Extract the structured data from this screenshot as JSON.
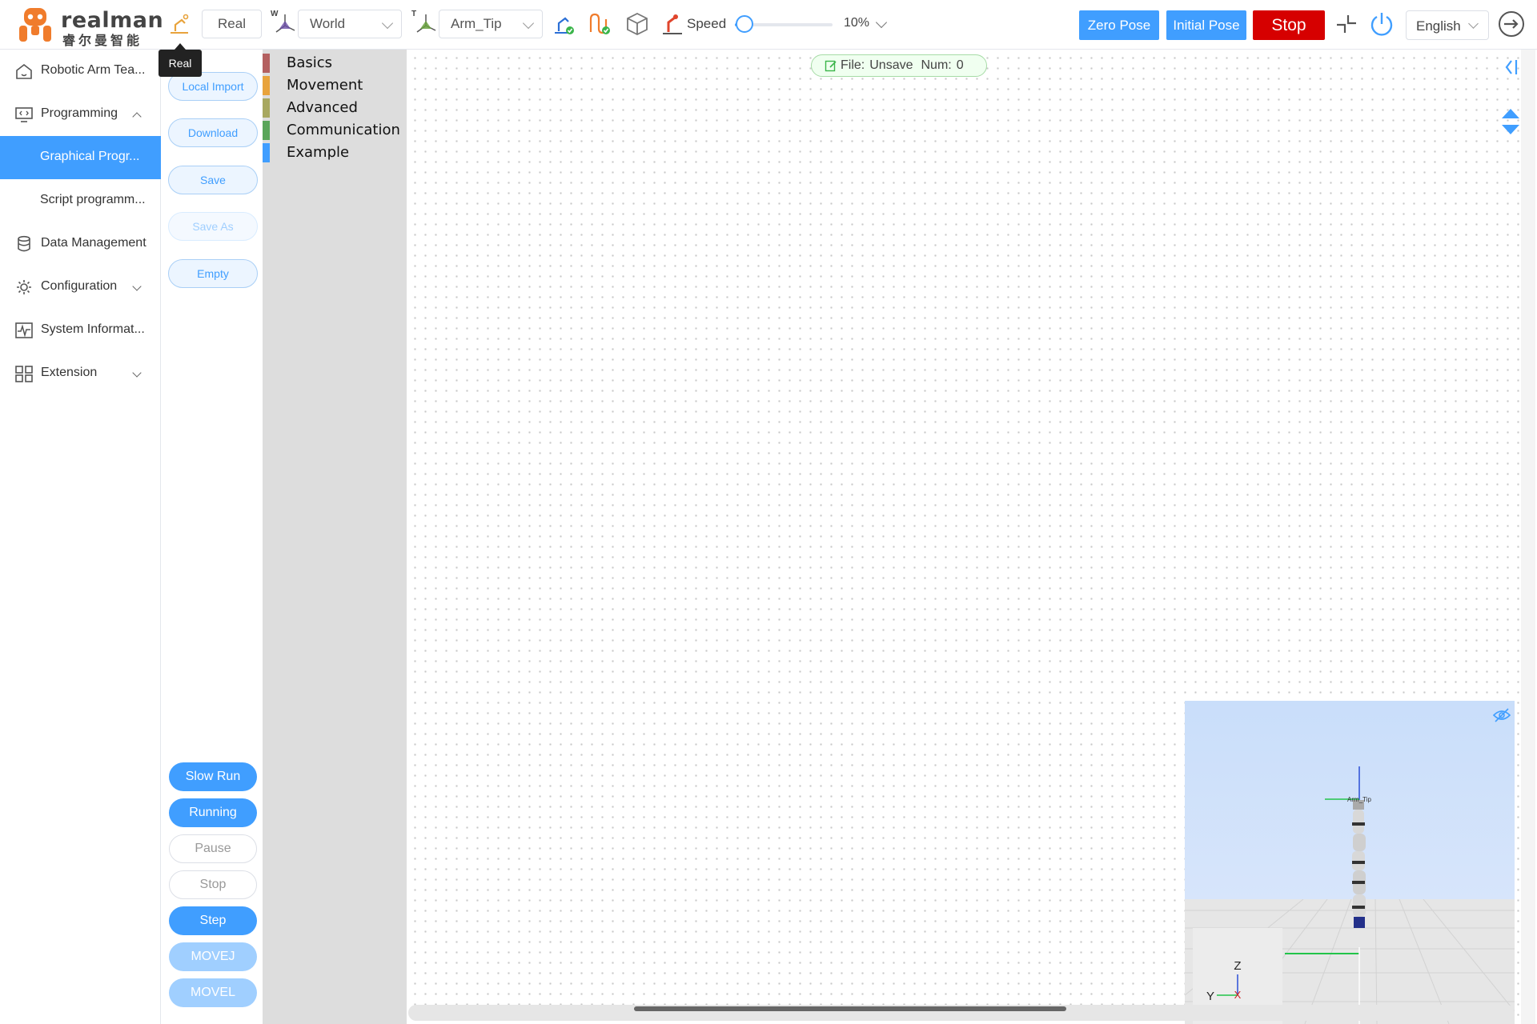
{
  "brand": {
    "name_en": "realman",
    "name_cn": "睿尔曼智能"
  },
  "toolbar": {
    "mode_value": "Real",
    "mode_tooltip": "Real",
    "frame_axis": "W",
    "frame_value": "World",
    "tool_axis": "T",
    "tool_value": "Arm_Tip",
    "speed_label": "Speed",
    "speed_value": "10%",
    "speed_percent": 10,
    "zero_pose": "Zero Pose",
    "initial_pose": "Initial Pose",
    "stop": "Stop",
    "language": "English"
  },
  "sidebar": {
    "items": [
      {
        "label": "Robotic Arm Tea..."
      },
      {
        "label": "Programming"
      },
      {
        "label": "Graphical Progr..."
      },
      {
        "label": "Script programm..."
      },
      {
        "label": "Data Management"
      },
      {
        "label": "Configuration"
      },
      {
        "label": "System Informat..."
      },
      {
        "label": "Extension"
      }
    ]
  },
  "tools": {
    "local_import": "Local Import",
    "download": "Download",
    "save": "Save",
    "save_as": "Save As",
    "empty": "Empty"
  },
  "run": {
    "slow_run": "Slow Run",
    "running": "Running",
    "pause": "Pause",
    "stop": "Stop",
    "step": "Step",
    "movej": "MOVEJ",
    "movel": "MOVEL"
  },
  "toolbox": {
    "categories": [
      {
        "label": "Basics",
        "color": "#b46060"
      },
      {
        "label": "Movement",
        "color": "#e8a33c"
      },
      {
        "label": "Advanced",
        "color": "#a8a860"
      },
      {
        "label": "Communication",
        "color": "#5aa55a"
      },
      {
        "label": "Example",
        "color": "#409eff"
      }
    ]
  },
  "workspace": {
    "file_label": "File:",
    "file_value": "Unsave",
    "num_label": "Num:",
    "num_value": "0"
  },
  "viewer": {
    "tool_tag": "Arm_Tip",
    "axis_z": "Z",
    "axis_y": "Y",
    "axis_x": "X"
  },
  "colors": {
    "accent": "#409eff",
    "stop": "#d60000",
    "brand_orange": "#f07c2c"
  }
}
